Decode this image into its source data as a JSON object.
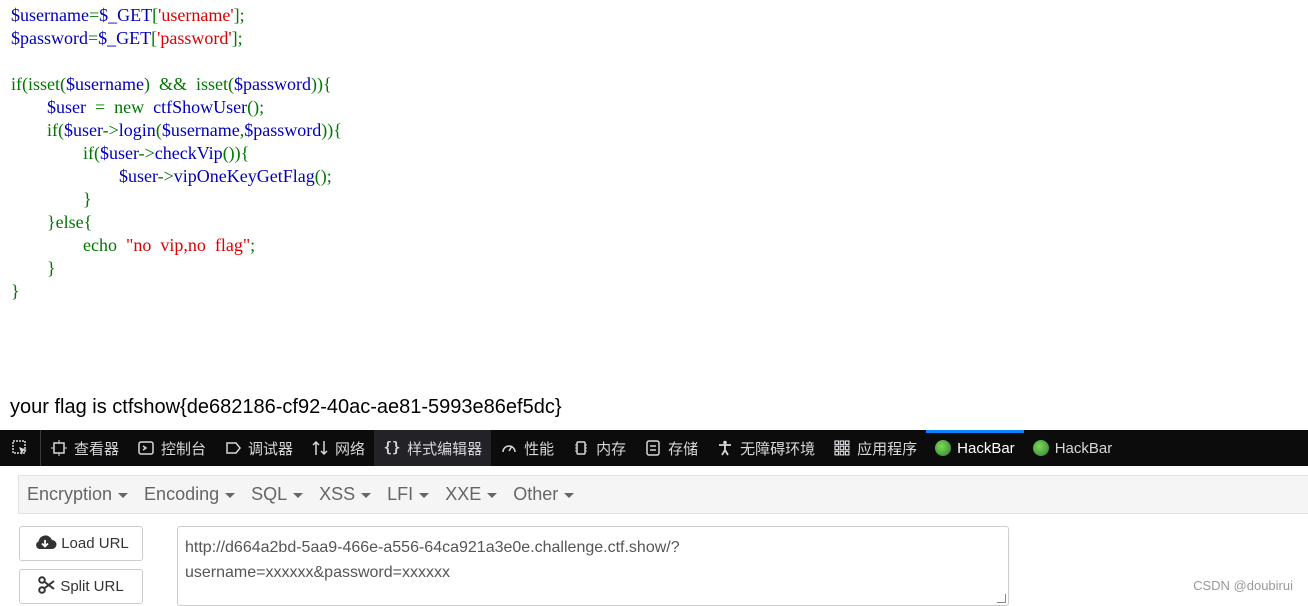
{
  "code": {
    "lines": [
      [
        {
          "t": "$username",
          "c": "var"
        },
        {
          "t": "=",
          "c": "kw"
        },
        {
          "t": "$_GET",
          "c": "var"
        },
        {
          "t": "[",
          "c": "kw"
        },
        {
          "t": "'username'",
          "c": "str"
        },
        {
          "t": "];",
          "c": "kw"
        }
      ],
      [
        {
          "t": "$password",
          "c": "var"
        },
        {
          "t": "=",
          "c": "kw"
        },
        {
          "t": "$_GET",
          "c": "var"
        },
        {
          "t": "[",
          "c": "kw"
        },
        {
          "t": "'password'",
          "c": "str"
        },
        {
          "t": "];",
          "c": "kw"
        }
      ],
      [],
      [
        {
          "t": "if(isset(",
          "c": "kw"
        },
        {
          "t": "$username",
          "c": "var"
        },
        {
          "t": ")  &&  isset(",
          "c": "kw"
        },
        {
          "t": "$password",
          "c": "var"
        },
        {
          "t": ")){",
          "c": "kw"
        }
      ],
      [
        {
          "t": "        ",
          "c": "kw"
        },
        {
          "t": "$user",
          "c": "var"
        },
        {
          "t": "  =  new  ",
          "c": "kw"
        },
        {
          "t": "ctfShowUser",
          "c": "var"
        },
        {
          "t": "();",
          "c": "kw"
        }
      ],
      [
        {
          "t": "        if(",
          "c": "kw"
        },
        {
          "t": "$user",
          "c": "var"
        },
        {
          "t": "->",
          "c": "kw"
        },
        {
          "t": "login",
          "c": "var"
        },
        {
          "t": "(",
          "c": "kw"
        },
        {
          "t": "$username",
          "c": "var"
        },
        {
          "t": ",",
          "c": "kw"
        },
        {
          "t": "$password",
          "c": "var"
        },
        {
          "t": ")){",
          "c": "kw"
        }
      ],
      [
        {
          "t": "                if(",
          "c": "kw"
        },
        {
          "t": "$user",
          "c": "var"
        },
        {
          "t": "->",
          "c": "kw"
        },
        {
          "t": "checkVip",
          "c": "var"
        },
        {
          "t": "()){",
          "c": "kw"
        }
      ],
      [
        {
          "t": "                        ",
          "c": "kw"
        },
        {
          "t": "$user",
          "c": "var"
        },
        {
          "t": "->",
          "c": "kw"
        },
        {
          "t": "vipOneKeyGetFlag",
          "c": "var"
        },
        {
          "t": "();",
          "c": "kw"
        }
      ],
      [
        {
          "t": "                }",
          "c": "kw"
        }
      ],
      [
        {
          "t": "        }else{",
          "c": "kw"
        }
      ],
      [
        {
          "t": "                echo  ",
          "c": "kw"
        },
        {
          "t": "\"no  vip,no  flag\"",
          "c": "str"
        },
        {
          "t": ";",
          "c": "kw"
        }
      ],
      [
        {
          "t": "        }",
          "c": "kw"
        }
      ],
      [
        {
          "t": "}",
          "c": "kw"
        }
      ]
    ]
  },
  "output": {
    "flag_line": "your flag is ctfshow{de682186-cf92-40ac-ae81-5993e86ef5dc}"
  },
  "devtools": {
    "tabs": [
      "查看器",
      "控制台",
      "调试器",
      "网络",
      "样式编辑器",
      "性能",
      "内存",
      "存储",
      "无障碍环境",
      "应用程序",
      "HackBar",
      "HackBar"
    ]
  },
  "hackbar": {
    "menu": [
      "Encryption",
      "Encoding",
      "SQL",
      "XSS",
      "LFI",
      "XXE",
      "Other"
    ],
    "load_url": "Load URL",
    "split_url": "Split URL",
    "url_line1": "http://d664a2bd-5aa9-466e-a556-64ca921a3e0e.challenge.ctf.show/?",
    "url_line2": "username=xxxxxx&password=xxxxxx"
  },
  "watermark": "CSDN @doubirui",
  "colors": {
    "var": "#0000BB",
    "keyword": "#007700",
    "string": "#DD0000",
    "devtools_bg": "#0c0c0d",
    "active_tab": "#0a84ff"
  }
}
